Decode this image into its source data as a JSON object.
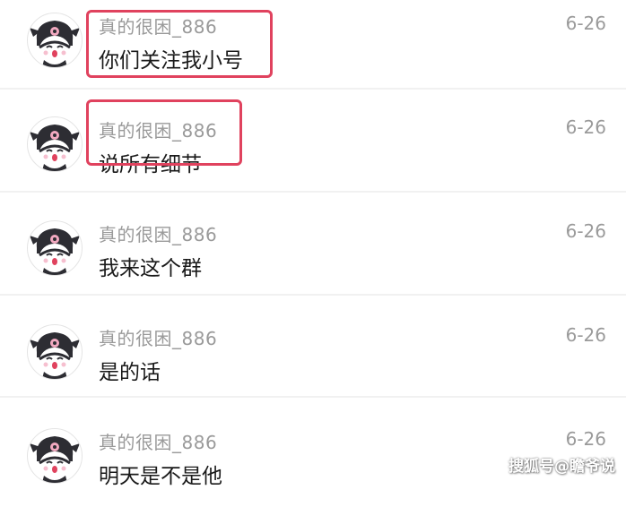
{
  "conversation": {
    "messages": [
      {
        "sender": "真的很困_886",
        "text": "你们关注我小号",
        "date": "6-26",
        "highlighted": true
      },
      {
        "sender": "真的很困_886",
        "text": "说所有细节",
        "date": "6-26",
        "highlighted": true
      },
      {
        "sender": "真的很困_886",
        "text": "我来这个群",
        "date": "6-26",
        "highlighted": false
      },
      {
        "sender": "真的很困_886",
        "text": "是的话",
        "date": "6-26",
        "highlighted": false
      },
      {
        "sender": "真的很困_886",
        "text": "明天是不是他",
        "date": "6-26",
        "highlighted": false
      }
    ]
  },
  "avatar": {
    "icon": "kuromi-avatar-icon"
  },
  "colors": {
    "highlight_border": "#e0425e",
    "sender_text": "#9a9a9a",
    "message_text": "#1a1a1a"
  },
  "watermark": {
    "text": "搜狐号@瞻爷说"
  }
}
